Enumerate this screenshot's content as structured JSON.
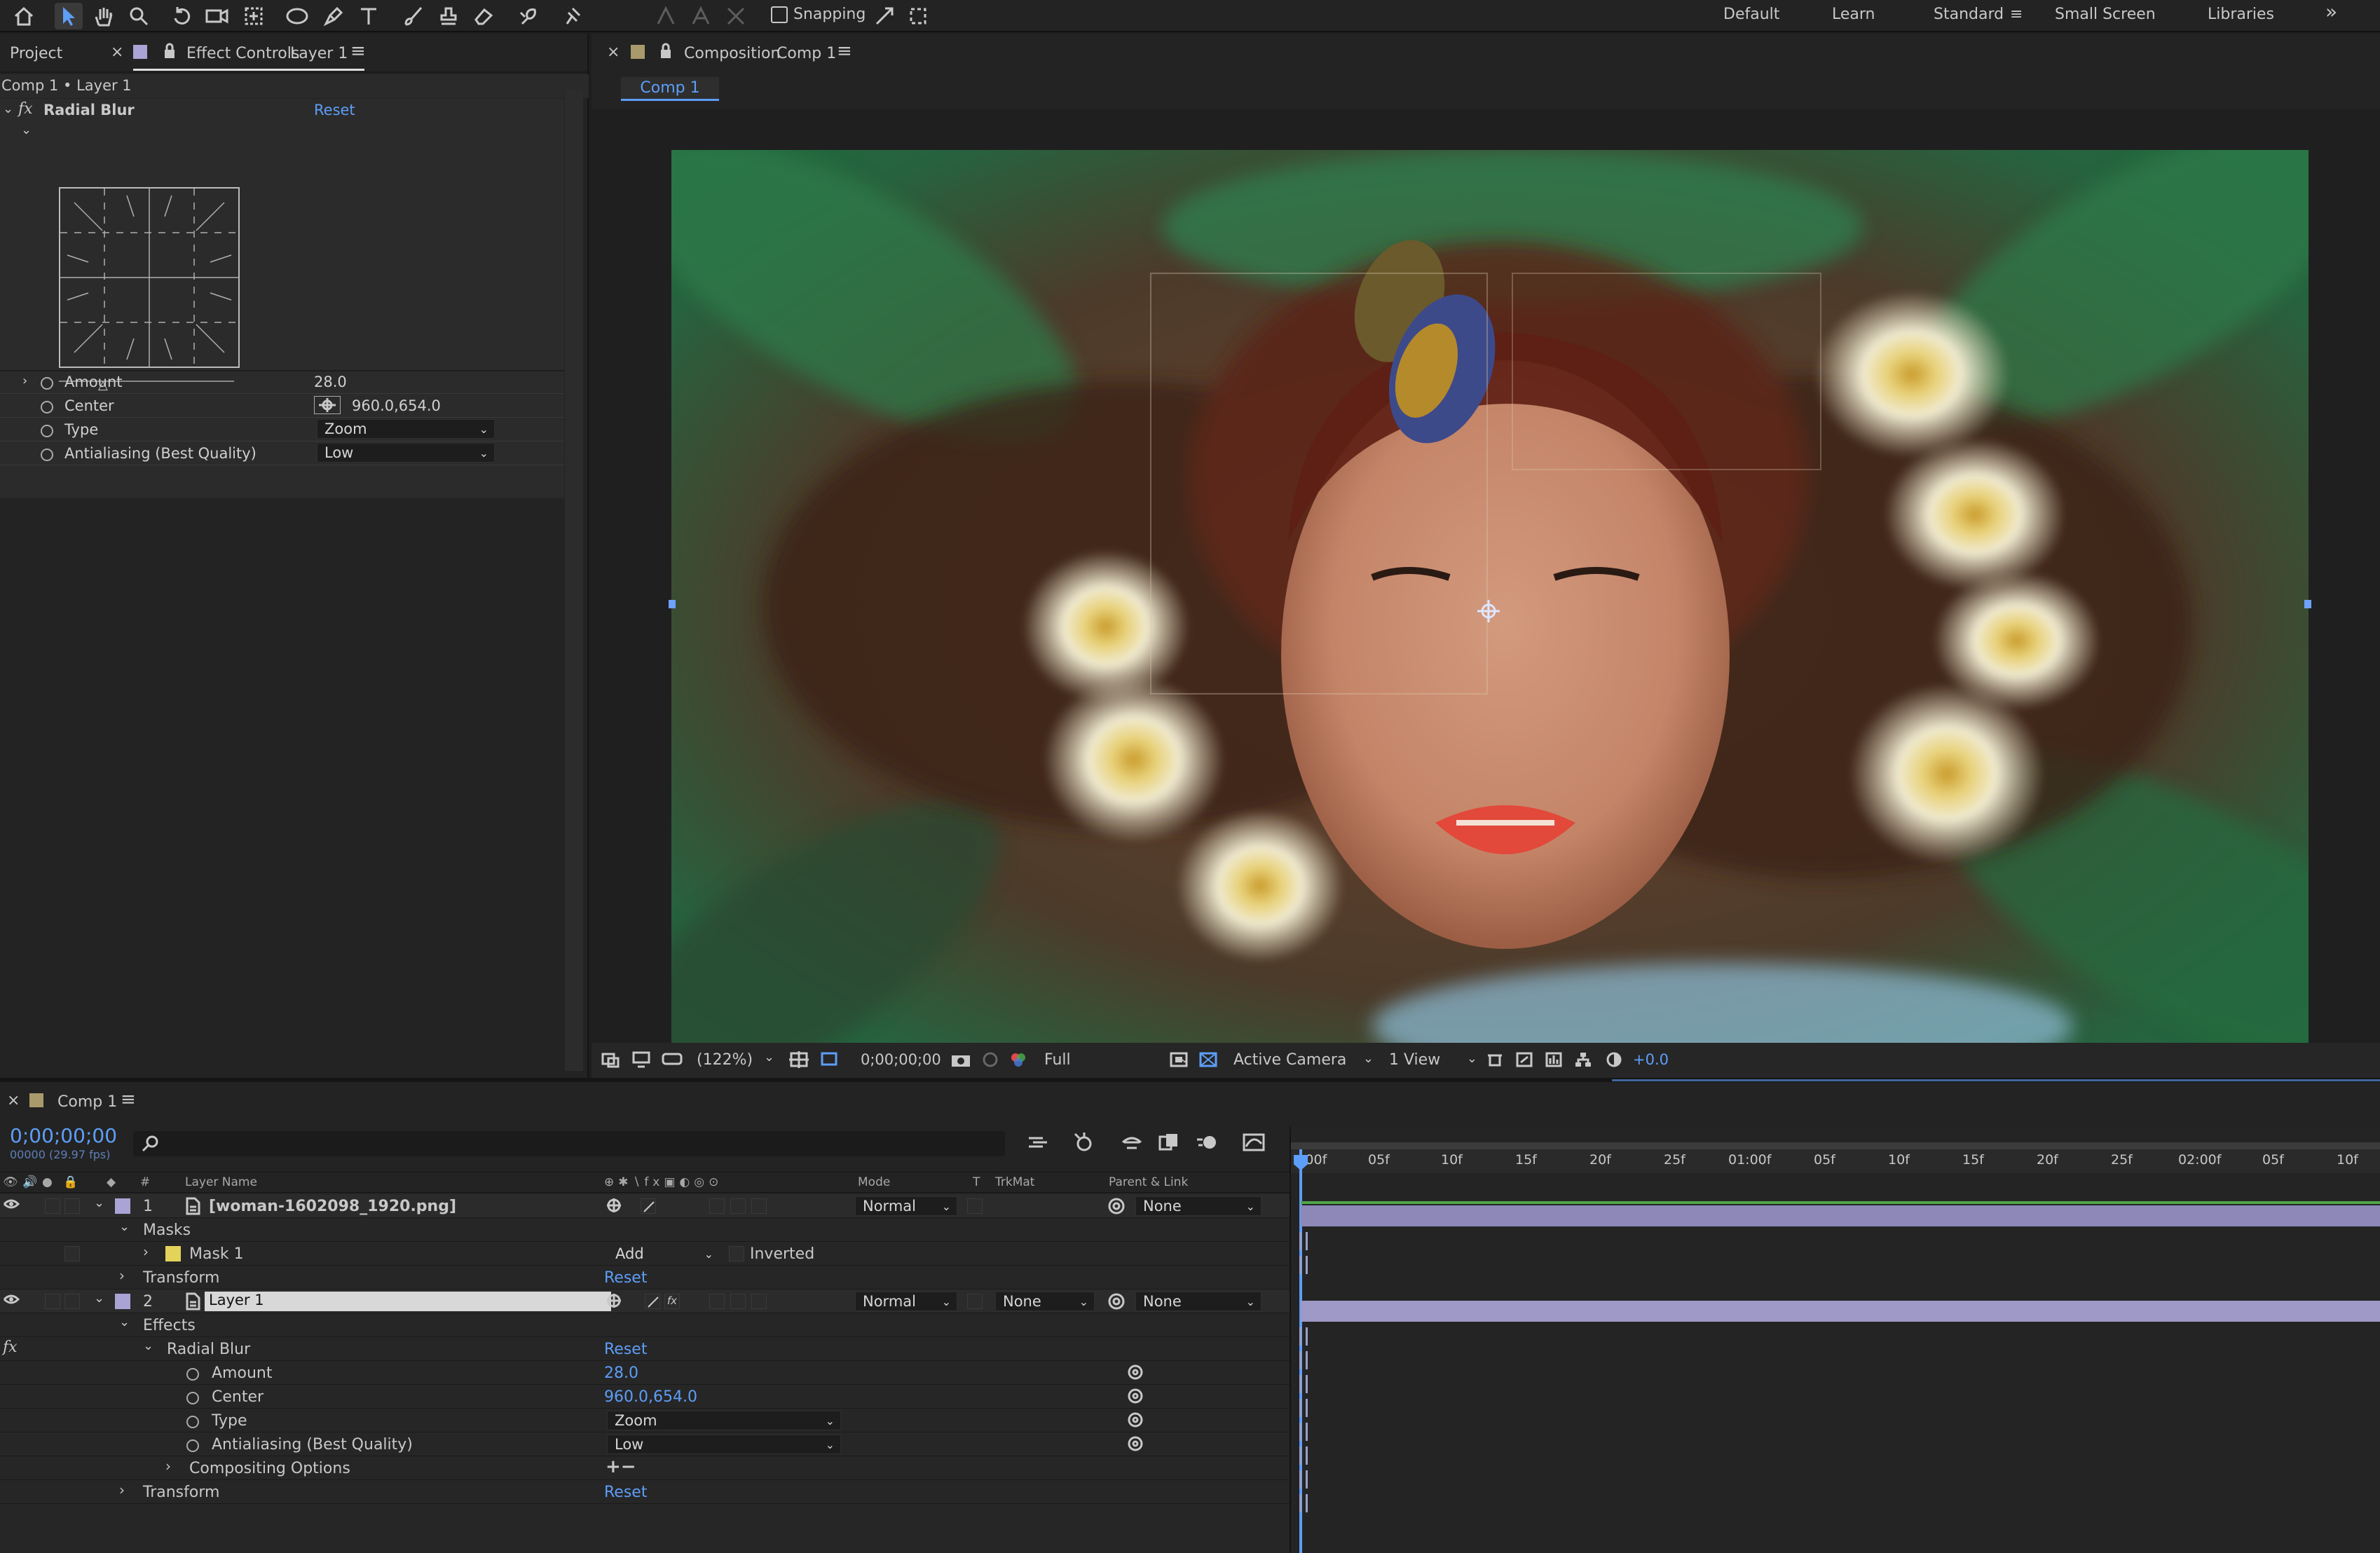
{
  "toolbar": {
    "snapping_label": "Snapping",
    "workspaces": [
      "Default",
      "Learn",
      "Standard",
      "Small Screen",
      "Libraries"
    ],
    "active_workspace": "Standard",
    "overflow": "»"
  },
  "left_panel": {
    "tab_project": "Project",
    "tab_effect_controls": "Effect Controls",
    "tab_effect_controls_target": "Layer 1",
    "breadcrumb": "Comp 1 • Layer 1",
    "effect_name": "Radial Blur",
    "effect_reset": "Reset",
    "props": [
      {
        "label": "Amount",
        "value": "28.0"
      },
      {
        "label": "Center",
        "value": "960.0,654.0"
      },
      {
        "label": "Type",
        "value": "Zoom"
      },
      {
        "label": "Antialiasing (Best Quality)",
        "value": "Low"
      }
    ]
  },
  "composition": {
    "tab_prefix": "Composition",
    "tab_name": "Comp 1",
    "subtab": "Comp 1",
    "footer": {
      "zoom": "(122%)",
      "timecode": "0;00;00;00",
      "resolution": "Full",
      "camera": "Active Camera",
      "views": "1 View",
      "exposure": "+0.0"
    }
  },
  "timeline": {
    "tab_name": "Comp 1",
    "timecode": "0;00;00;00",
    "frame_info": "00000 (29.97 fps)",
    "ruler": [
      ":00f",
      "05f",
      "10f",
      "15f",
      "20f",
      "25f",
      "01:00f",
      "05f",
      "10f",
      "15f",
      "20f",
      "25f",
      "02:00f",
      "05f",
      "10f"
    ],
    "col_headers": {
      "num": "#",
      "layer_name": "Layer Name",
      "mode": "Mode",
      "t": "T",
      "trkmat": "TrkMat",
      "parent": "Parent & Link"
    },
    "layer1": {
      "num": "1",
      "name": "[woman-1602098_1920.png]",
      "mode": "Normal",
      "parent": "None"
    },
    "masks_label": "Masks",
    "mask1": {
      "name": "Mask 1",
      "mode": "Add",
      "inverted": "Inverted"
    },
    "transform_label": "Transform",
    "reset_label": "Reset",
    "layer2": {
      "num": "2",
      "name": "Layer 1",
      "mode": "Normal",
      "trkmat": "None",
      "parent": "None"
    },
    "effects_label": "Effects",
    "radial_blur_label": "Radial Blur",
    "props": [
      {
        "label": "Amount",
        "value": "28.0"
      },
      {
        "label": "Center",
        "value": "960.0,654.0"
      },
      {
        "label": "Type",
        "value": "Zoom"
      },
      {
        "label": "Antialiasing (Best Quality)",
        "value": "Low"
      }
    ],
    "compositing_options": "Compositing Options",
    "transform_label2": "Transform"
  },
  "colors": {
    "accent": "#5d9ef8",
    "layer_label": "#a9a3d6",
    "bar": "#8d88b8"
  }
}
